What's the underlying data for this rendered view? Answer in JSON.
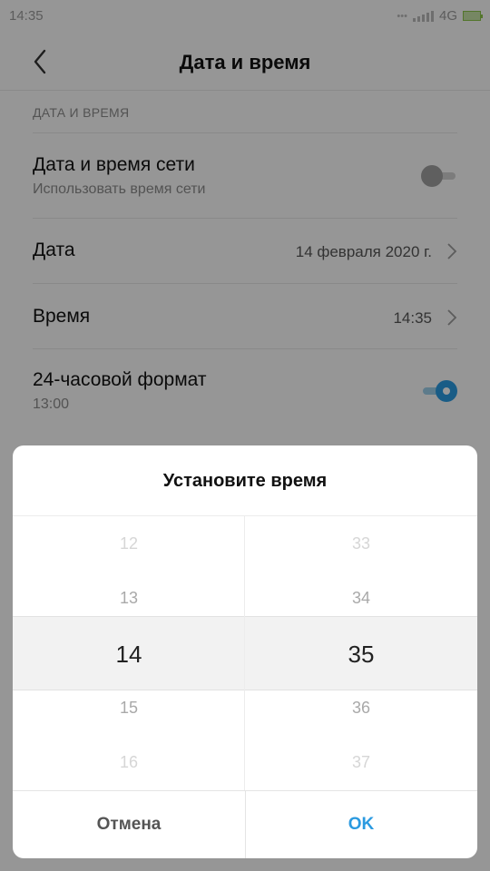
{
  "status_bar": {
    "time": "14:35",
    "network": "4G"
  },
  "header": {
    "title": "Дата и время"
  },
  "section": {
    "label": "ДАТА И ВРЕМЯ"
  },
  "rows": {
    "network_time": {
      "title": "Дата и время сети",
      "subtitle": "Использовать время сети",
      "toggle": "off"
    },
    "date": {
      "title": "Дата",
      "value": "14 февраля 2020 г."
    },
    "time": {
      "title": "Время",
      "value": "14:35"
    },
    "format24": {
      "title": "24-часовой формат",
      "subtitle": "13:00",
      "toggle": "on"
    }
  },
  "dialog": {
    "title": "Установите время",
    "hours": [
      "12",
      "13",
      "14",
      "15",
      "16"
    ],
    "minutes": [
      "33",
      "34",
      "35",
      "36",
      "37"
    ],
    "cancel_label": "Отмена",
    "ok_label": "OK"
  },
  "colors": {
    "accent": "#2b9ae0",
    "dim_overlay": "rgba(0,0,0,0.4)"
  }
}
